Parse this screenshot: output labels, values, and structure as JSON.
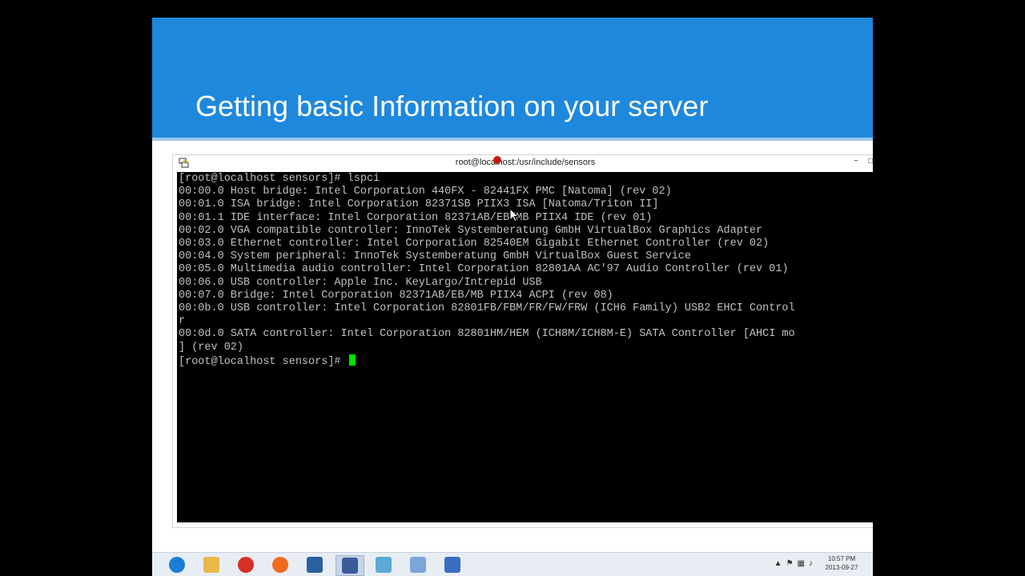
{
  "slide": {
    "title": "Getting basic Information on your server"
  },
  "window": {
    "title": "root@localhost:/usr/include/sensors",
    "minimize_label": "−",
    "maximize_label": "□"
  },
  "terminal": {
    "lines": [
      "[root@localhost sensors]# lspci",
      "00:00.0 Host bridge: Intel Corporation 440FX - 82441FX PMC [Natoma] (rev 02)",
      "00:01.0 ISA bridge: Intel Corporation 82371SB PIIX3 ISA [Natoma/Triton II]",
      "00:01.1 IDE interface: Intel Corporation 82371AB/EB/MB PIIX4 IDE (rev 01)",
      "00:02.0 VGA compatible controller: InnoTek Systemberatung GmbH VirtualBox Graphics Adapter",
      "00:03.0 Ethernet controller: Intel Corporation 82540EM Gigabit Ethernet Controller (rev 02)",
      "00:04.0 System peripheral: InnoTek Systemberatung GmbH VirtualBox Guest Service",
      "00:05.0 Multimedia audio controller: Intel Corporation 82801AA AC'97 Audio Controller (rev 01)",
      "00:06.0 USB controller: Apple Inc. KeyLargo/Intrepid USB",
      "00:07.0 Bridge: Intel Corporation 82371AB/EB/MB PIIX4 ACPI (rev 08)",
      "00:0b.0 USB controller: Intel Corporation 82801FB/FBM/FR/FW/FRW (ICH6 Family) USB2 EHCI Control",
      "r",
      "00:0d.0 SATA controller: Intel Corporation 82801HM/HEM (ICH8M/ICH8M-E) SATA Controller [AHCI mo",
      "] (rev 02)"
    ],
    "prompt": "[root@localhost sensors]# "
  },
  "taskbar": {
    "apps": [
      {
        "name": "ie-icon",
        "color": "#1a7fd4"
      },
      {
        "name": "file-explorer-icon",
        "color": "#e8b84a"
      },
      {
        "name": "chrome-icon",
        "color": "#d93025"
      },
      {
        "name": "origin-icon",
        "color": "#f06a1e"
      },
      {
        "name": "virtualbox-icon",
        "color": "#2c5fa0"
      },
      {
        "name": "putty-icon",
        "color": "#3a5a9a"
      },
      {
        "name": "app-icon",
        "color": "#5aa9d6"
      },
      {
        "name": "paint-icon",
        "color": "#7aa6d8"
      },
      {
        "name": "save-icon",
        "color": "#3b6dbf"
      }
    ],
    "clock_time": "10:57 PM",
    "clock_date": "2013-09-27"
  }
}
